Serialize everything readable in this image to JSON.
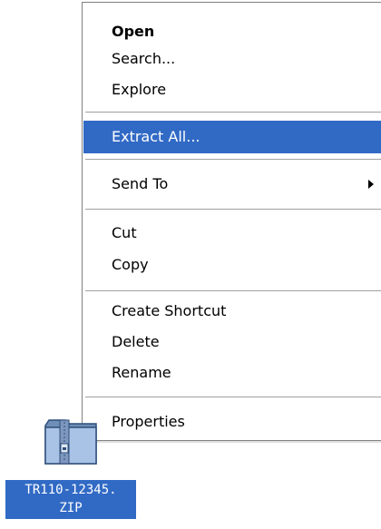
{
  "context_menu": {
    "items": [
      {
        "label": "Open",
        "bold": true
      },
      {
        "label": "Search..."
      },
      {
        "label": "Explore"
      },
      {
        "label": "Extract All...",
        "highlighted": true
      },
      {
        "label": "Send To",
        "submenu": true
      },
      {
        "label": "Cut"
      },
      {
        "label": "Copy"
      },
      {
        "label": "Create Shortcut"
      },
      {
        "label": "Delete"
      },
      {
        "label": "Rename"
      },
      {
        "label": "Properties"
      }
    ],
    "highlight_color": "#316ac5"
  },
  "desktop_icon": {
    "label_line1": "TR110-12345.",
    "label_line2": "ZIP",
    "icon": "zip-folder-icon",
    "selected": true
  }
}
